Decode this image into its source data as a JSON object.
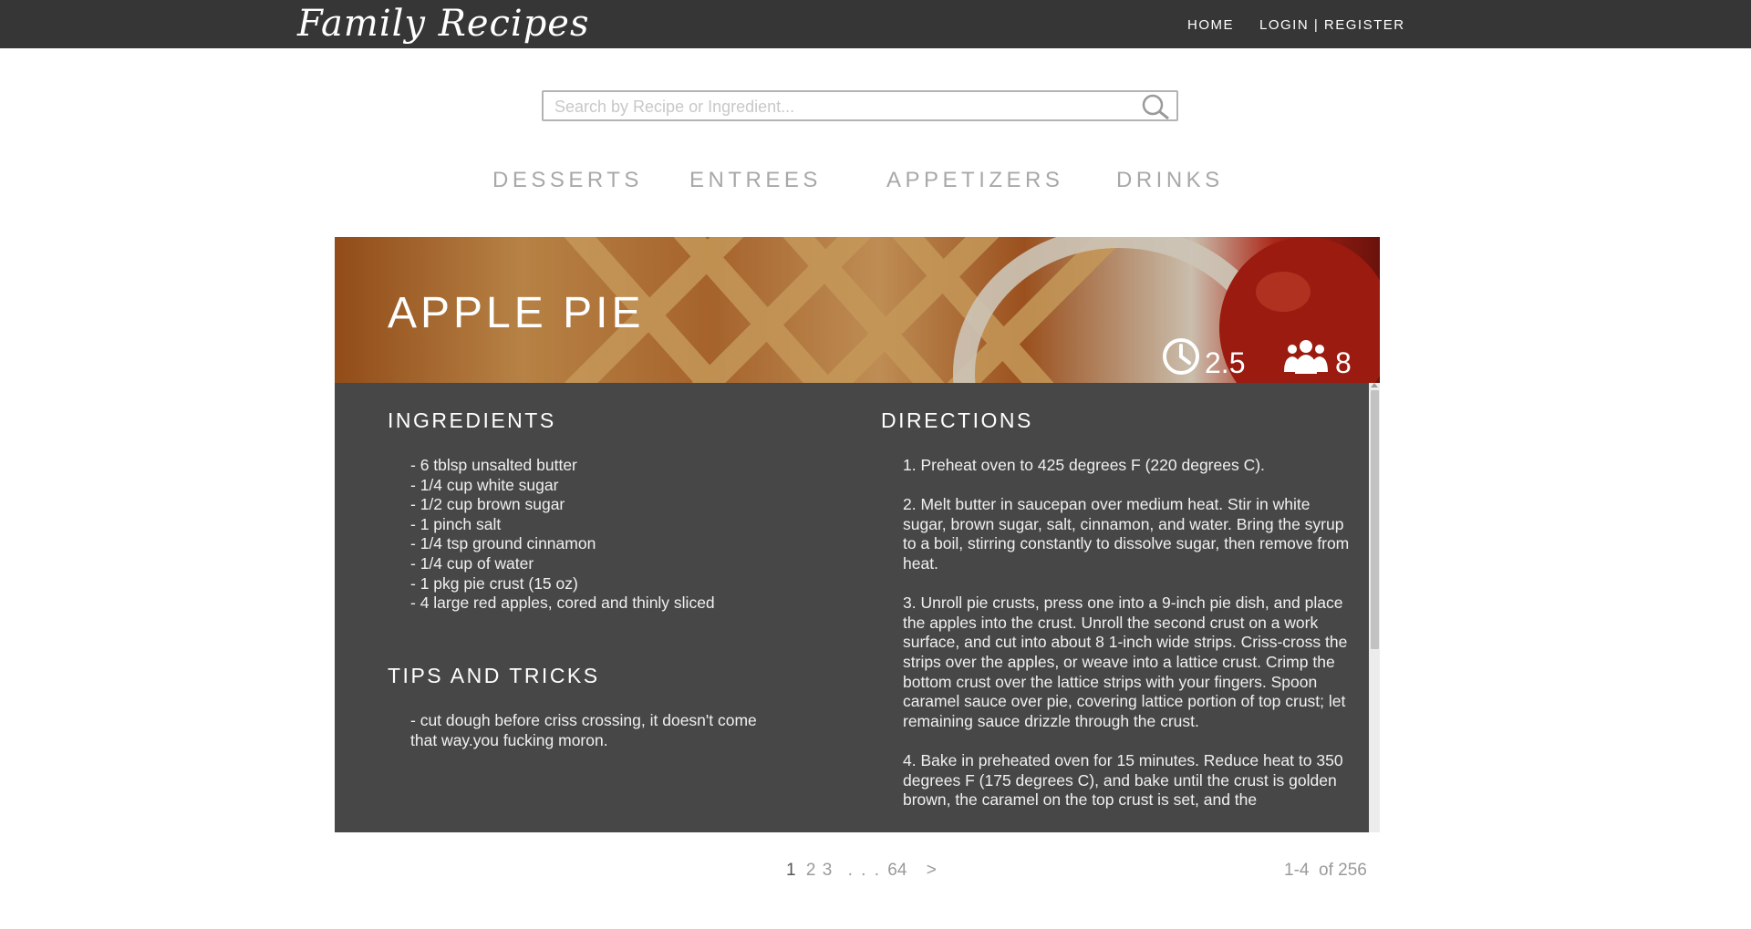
{
  "brand": {
    "logo_text": "Family Recipes"
  },
  "nav": {
    "home": "HOME",
    "login": "LOGIN | REGISTER"
  },
  "search": {
    "placeholder": "Search by Recipe or Ingredient..."
  },
  "categories": [
    "DESSERTS",
    "ENTREES",
    "APPETIZERS",
    "DRINKS"
  ],
  "recipe": {
    "title": "APPLE PIE",
    "time": "2.5",
    "servings": "8",
    "ingredients_heading": "INGREDIENTS",
    "ingredients": [
      "- 6 tblsp unsalted butter",
      "- 1/4 cup white sugar",
      "- 1/2 cup brown sugar",
      "- 1 pinch salt",
      "- 1/4 tsp ground cinnamon",
      "- 1/4 cup of water",
      "- 1 pkg pie crust (15 oz)",
      "- 4 large red apples, cored and thinly sliced"
    ],
    "tips_heading": "TIPS AND TRICKS",
    "tip": "- cut dough before criss crossing, it doesn't come that way.you fucking moron.",
    "directions_heading": "DIRECTIONS",
    "directions": [
      "1. Preheat oven to 425 degrees F (220 degrees C).",
      "2. Melt butter in saucepan over medium heat. Stir in white sugar, brown sugar, salt, cinnamon, and water. Bring the syrup to a boil, stirring constantly to dissolve sugar, then remove from heat.",
      "3. Unroll pie crusts, press one into a 9-inch pie dish, and place the apples into the crust. Unroll the second crust on a work surface, and cut into about 8 1-inch wide strips. Criss-cross the strips over the apples, or weave into a lattice crust. Crimp the bottom crust over the lattice strips with your fingers. Spoon caramel sauce over pie, covering lattice portion of top crust; let remaining sauce drizzle through the crust.",
      "4. Bake in preheated oven for 15 minutes. Reduce heat to 350 degrees F (175 degrees C), and bake until the crust is golden brown, the caramel on the top crust is set, and the"
    ]
  },
  "pagination": {
    "current": "1",
    "p2": "2",
    "p3": "3",
    "ellipsis": ". . .",
    "last": "64",
    "next": ">",
    "range": "1-4  of 256"
  },
  "colors": {
    "topbar": "#363636",
    "panel": "#474747",
    "muted": "#a8a8a8"
  },
  "icons": {
    "search": "search-icon",
    "time": "clock-icon",
    "servings": "people-icon"
  }
}
